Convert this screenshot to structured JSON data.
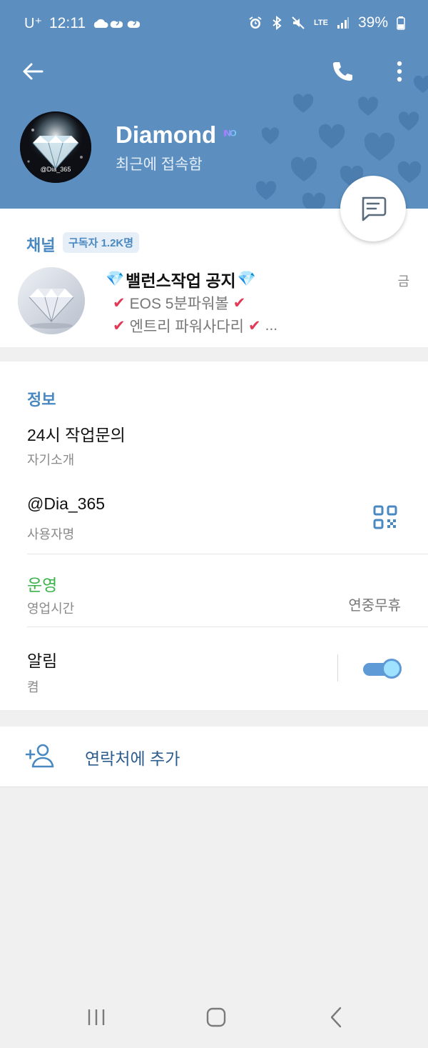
{
  "status_bar": {
    "carrier": "U⁺",
    "time": "12:11",
    "lte": "LTE",
    "battery": "39%"
  },
  "profile": {
    "name": "Diamond",
    "name_badge": "ᴵᴺᴼ",
    "status": "최근에 접속함",
    "avatar_caption": "@Dia_365"
  },
  "channel": {
    "section_label": "채널",
    "subscribers": "구독자 1.2K명",
    "diamond_emoji": "💎",
    "name": "밸런스작업 공지",
    "date": "금",
    "line1_text": "EOS 5분파워볼",
    "line2_text": "엔트리 파워사다리",
    "check": "✔",
    "ellipsis": "..."
  },
  "info": {
    "section_label": "정보",
    "bio_value": "24시 작업문의",
    "bio_label": "자기소개",
    "username_value": "@Dia_365",
    "username_label": "사용자명",
    "hours_status": "운영",
    "hours_label": "영업시간",
    "hours_value": "연중무휴",
    "notifications_title": "알림",
    "notifications_value": "켬",
    "notifications_on": true
  },
  "actions": {
    "add_contact": "연락처에 추가"
  },
  "colors": {
    "header_bg": "#5c8fc0",
    "accent_blue": "#4a88c2",
    "status_green": "#3bb34a",
    "toggle_on": "#5e9ad6"
  },
  "icons": {
    "back": "arrow-left-icon",
    "call": "phone-icon",
    "more": "more-vertical-icon",
    "message": "message-icon",
    "qr": "qr-code-icon",
    "add_contact": "add-person-icon"
  }
}
